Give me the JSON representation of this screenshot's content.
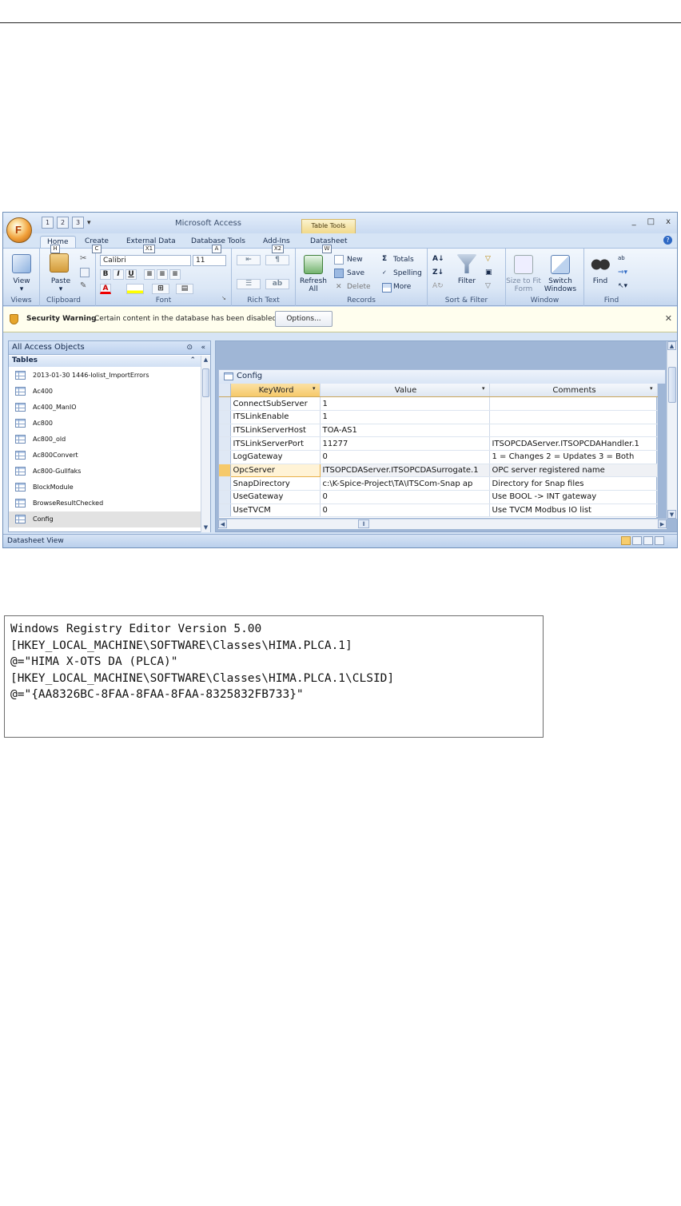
{
  "window": {
    "title": "Microsoft Access",
    "contextual_tab_group": "Table Tools",
    "controls": [
      "_",
      "□",
      "x"
    ],
    "qat_keytips": [
      "1",
      "2",
      "3"
    ]
  },
  "office_button": {
    "keytip": "F"
  },
  "tabs": [
    {
      "label": "Home",
      "keytip": "H"
    },
    {
      "label": "Create",
      "keytip": "C"
    },
    {
      "label": "External Data",
      "keytip": "X1"
    },
    {
      "label": "Database Tools",
      "keytip": "A"
    },
    {
      "label": "Add-Ins",
      "keytip": "X2"
    },
    {
      "label": "Datasheet",
      "keytip": "W"
    }
  ],
  "ribbon": {
    "views": {
      "view_label": "View",
      "group": "Views"
    },
    "clipboard": {
      "paste_label": "Paste",
      "group": "Clipboard"
    },
    "font": {
      "font_name": "Calibri",
      "font_size": "11",
      "bold": "B",
      "italic": "I",
      "underline": "U",
      "font_color": "A",
      "group": "Font"
    },
    "rich_text": {
      "group": "Rich Text"
    },
    "records": {
      "refresh_label": "Refresh All",
      "new": "New",
      "save": "Save",
      "delete": "Delete",
      "totals": "Totals",
      "spelling": "Spelling",
      "more": "More",
      "group": "Records"
    },
    "sort_filter": {
      "filter_label": "Filter",
      "group": "Sort & Filter"
    },
    "window": {
      "size_to_fit": "Size to Fit Form",
      "switch": "Switch Windows",
      "group": "Window"
    },
    "find": {
      "find_label": "Find",
      "group": "Find"
    }
  },
  "security_bar": {
    "title": "Security Warning",
    "message": "Certain content in the database has been disabled",
    "options_label": "Options..."
  },
  "nav_pane": {
    "header": "All Access Objects",
    "section": "Tables",
    "items": [
      {
        "label": "2013-01-30 1446-Iolist_ImportErrors"
      },
      {
        "label": "Ac400"
      },
      {
        "label": "Ac400_ManIO"
      },
      {
        "label": "Ac800"
      },
      {
        "label": "Ac800_old"
      },
      {
        "label": "Ac800Convert"
      },
      {
        "label": "Ac800-Gullfaks"
      },
      {
        "label": "BlockModule"
      },
      {
        "label": "BrowseResultChecked"
      },
      {
        "label": "Config"
      }
    ]
  },
  "datasheet": {
    "tab_title": "Config",
    "columns": [
      "KeyWord",
      "Value",
      "Comments"
    ],
    "rows": [
      {
        "keyword": "ConnectSubServer",
        "value": "1",
        "comments": ""
      },
      {
        "keyword": "ITSLinkEnable",
        "value": "1",
        "comments": ""
      },
      {
        "keyword": "ITSLinkServerHost",
        "value": "TOA-AS1",
        "comments": ""
      },
      {
        "keyword": "ITSLinkServerPort",
        "value": "11277",
        "comments": "ITSOPCDAServer.ITSOPCDAHandler.1"
      },
      {
        "keyword": "LogGateway",
        "value": "0",
        "comments": "1 = Changes 2 = Updates 3 = Both"
      },
      {
        "keyword": "OpcServer",
        "value": "ITSOPCDAServer.ITSOPCDASurrogate.1",
        "comments": "OPC server registered name"
      },
      {
        "keyword": "SnapDirectory",
        "value": "c:\\K-Spice-Project\\TA\\ITSCom-Snap ap",
        "comments": "Directory for Snap files"
      },
      {
        "keyword": "UseGateway",
        "value": "0",
        "comments": "Use BOOL -> INT gateway"
      },
      {
        "keyword": "UseTVCM",
        "value": "0",
        "comments": "Use TVCM Modbus IO list"
      }
    ]
  },
  "status_bar": {
    "text": "Datasheet View"
  },
  "registry": {
    "lines": [
      "Windows Registry Editor Version 5.00",
      "",
      "[HKEY_LOCAL_MACHINE\\SOFTWARE\\Classes\\HIMA.PLCA.1]",
      "@=\"HIMA X-OTS DA (PLCA)\"",
      "",
      "[HKEY_LOCAL_MACHINE\\SOFTWARE\\Classes\\HIMA.PLCA.1\\CLSID]",
      "@=\"{AA8326BC-8FAA-8FAA-8FAA-8325832FB733}\""
    ]
  }
}
